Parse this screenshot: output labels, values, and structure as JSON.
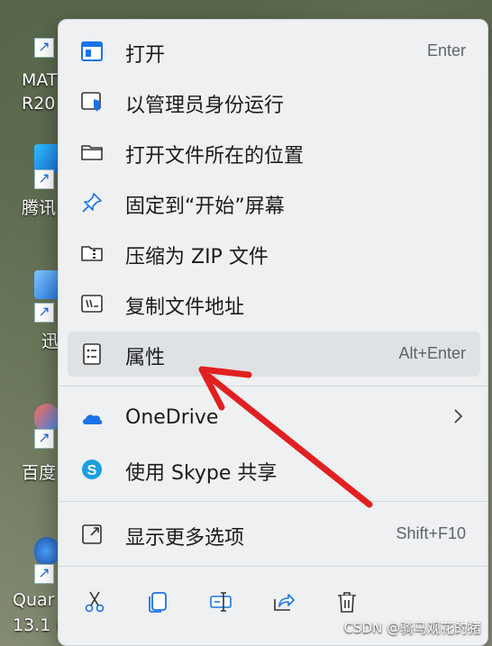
{
  "desktop": {
    "icons": [
      {
        "label": "MAT\nR20"
      },
      {
        "label": "腾讯"
      },
      {
        "label": "迅"
      },
      {
        "label": "百度"
      },
      {
        "label": "Quar\n13.1 ("
      }
    ]
  },
  "menu": {
    "items": [
      {
        "label": "打开",
        "shortcut": "Enter",
        "icon": "open-window-icon"
      },
      {
        "label": "以管理员身份运行",
        "shortcut": "",
        "icon": "admin-shield-icon"
      },
      {
        "label": "打开文件所在的位置",
        "shortcut": "",
        "icon": "folder-icon"
      },
      {
        "label": "固定到“开始”屏幕",
        "shortcut": "",
        "icon": "pin-icon"
      },
      {
        "label": "压缩为 ZIP 文件",
        "shortcut": "",
        "icon": "zip-folder-icon"
      },
      {
        "label": "复制文件地址",
        "shortcut": "",
        "icon": "copy-path-icon"
      },
      {
        "label": "属性",
        "shortcut": "Alt+Enter",
        "icon": "properties-icon"
      }
    ],
    "share_items": [
      {
        "label": "OneDrive",
        "icon": "onedrive-icon",
        "has_submenu": true
      },
      {
        "label": "使用 Skype 共享",
        "icon": "skype-icon",
        "has_submenu": false
      }
    ],
    "more_options": {
      "label": "显示更多选项",
      "shortcut": "Shift+F10",
      "icon": "more-options-icon"
    },
    "bottom_actions": [
      "cut-icon",
      "copy-icon",
      "rename-icon",
      "share-icon",
      "delete-icon"
    ]
  },
  "colors": {
    "accent": "#1a73e8",
    "annotation": "#e02020"
  },
  "watermark": "CSDN @骑马观花的猪"
}
